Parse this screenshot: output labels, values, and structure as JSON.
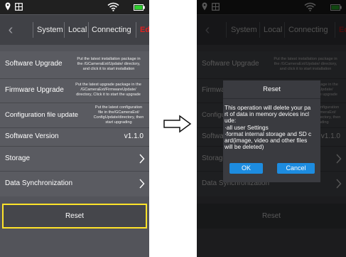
{
  "status_bar": {
    "icons": [
      "location-icon",
      "gallery-icon",
      "wifi-icon",
      "battery-icon"
    ],
    "battery_color": "#2fd12f"
  },
  "tabs": [
    {
      "label": "System"
    },
    {
      "label": "Local"
    },
    {
      "label": "Connecting"
    },
    {
      "label": "Edit"
    }
  ],
  "settings": {
    "software_upgrade": {
      "title": "Software Upgrade",
      "description": [
        "Put the latest installation package in",
        "the /GCameraExt/Update/ directory,",
        "and click it to start installation"
      ]
    },
    "firmware_upgrade": {
      "title": "Firmware Upgrade",
      "description": [
        "Put the latest upgrade package in the",
        "/GCameraExt/FirmwareUpdate/",
        "directory, Click it to start the upgrade"
      ]
    },
    "config_update": {
      "title": "Configuration file update",
      "description": [
        "Put the latest configuration",
        "file in the/GCameraExt/",
        "ConfigUpdate/directory, then",
        "start upgrading"
      ]
    },
    "software_version": {
      "title": "Software Version",
      "value": "v1.1.0"
    },
    "storage": {
      "title": "Storage"
    },
    "data_sync": {
      "title": "Data Synchronization"
    },
    "reset": {
      "label": "Reset"
    }
  },
  "dialog": {
    "title": "Reset",
    "message_lines": [
      "This operation will delete your pa",
      "rt of data in memory devices incl",
      "ude:",
      "·all user Settings",
      "·format internal storage and SD c",
      "ard(image, video and other files",
      "will be deleted)"
    ],
    "ok_label": "OK",
    "cancel_label": "Cancel"
  },
  "colors": {
    "highlight": "#ffe32a",
    "active_tab": "#e02020",
    "dialog_button": "#1d8ce0"
  }
}
